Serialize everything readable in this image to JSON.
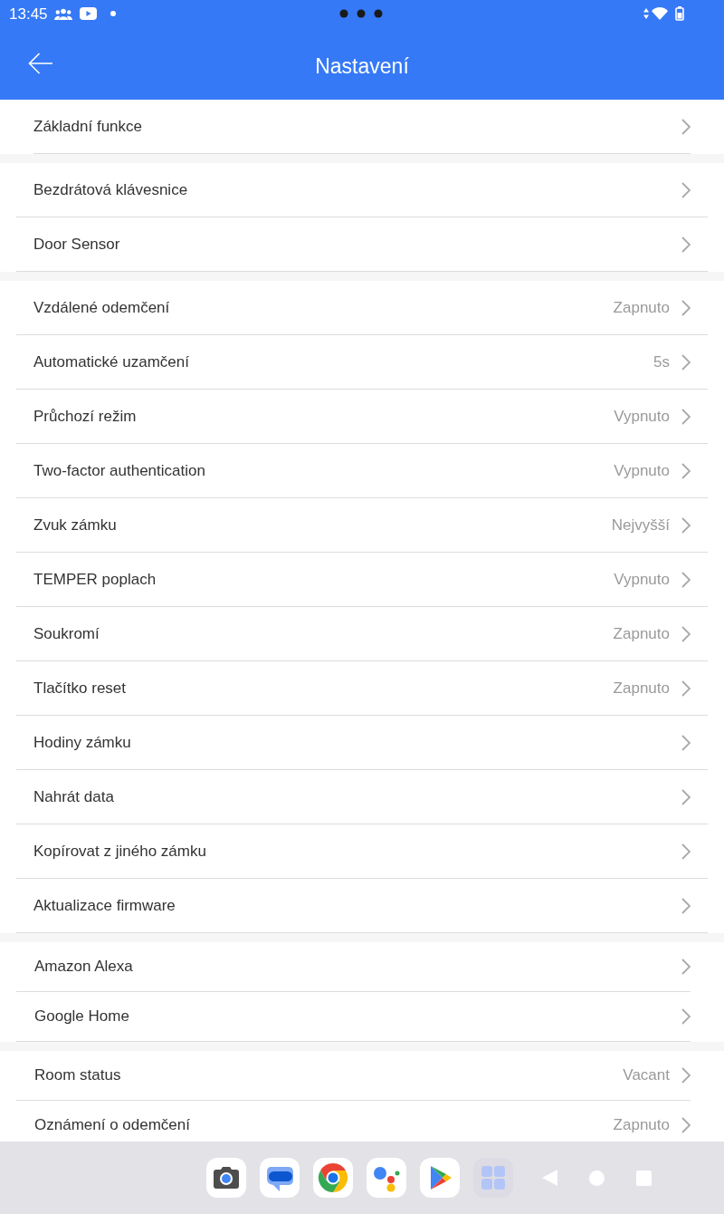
{
  "status_bar": {
    "time": "13:45"
  },
  "header": {
    "title": "Nastavení"
  },
  "groups": [
    {
      "rows": [
        {
          "label": "Základní funkce"
        }
      ]
    },
    {
      "rows": [
        {
          "label": "Bezdrátová klávesnice"
        },
        {
          "label": "Door Sensor"
        }
      ]
    },
    {
      "rows": [
        {
          "label": "Vzdálené odemčení",
          "value": "Zapnuto"
        },
        {
          "label": "Automatické uzamčení",
          "value": "5s"
        },
        {
          "label": "Průchozí režim",
          "value": "Vypnuto"
        },
        {
          "label": "Two-factor authentication",
          "value": "Vypnuto"
        },
        {
          "label": "Zvuk zámku",
          "value": "Nejvyšší"
        },
        {
          "label": "TEMPER poplach",
          "value": "Vypnuto"
        },
        {
          "label": "Soukromí",
          "value": "Zapnuto"
        },
        {
          "label": "Tlačítko reset",
          "value": "Zapnuto"
        },
        {
          "label": "Hodiny zámku"
        },
        {
          "label": "Nahrát data"
        },
        {
          "label": "Kopírovat z jiného zámku"
        },
        {
          "label": "Aktualizace firmware"
        }
      ]
    },
    {
      "rows": [
        {
          "label": "Amazon Alexa"
        },
        {
          "label": "Google Home"
        }
      ]
    },
    {
      "rows": [
        {
          "label": "Room status",
          "value": "Vacant"
        },
        {
          "label": "Oznámení o odemčení",
          "value": "Zapnuto"
        }
      ]
    }
  ]
}
